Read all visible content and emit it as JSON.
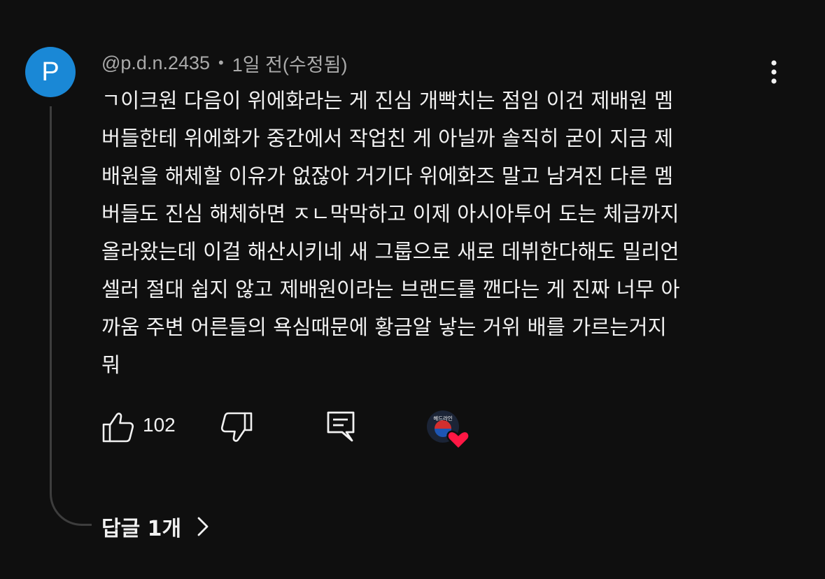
{
  "comment": {
    "avatar_letter": "P",
    "avatar_color": "#1a88d6",
    "author": "@p.d.n.2435",
    "separator": "•",
    "timestamp": "1일 전(수정됨)",
    "text": "ㄱ이크원 다음이 위에화라는 게 진심 개빡치는 점임 이건 제배원 멤\n버들한테 위에화가 중간에서 작업친 게 아닐까 솔직히 굳이 지금 제\n배원을 해체할 이유가 없잖아 거기다 위에화즈 말고 남겨진 다른 멤\n버들도 진심 해체하면 ㅈㄴ막막하고 이제 아시아투어 도는 체급까지\n올라왔는데 이걸 해산시키네 새 그룹으로 새로 데뷔한다해도 밀리언\n셀러 절대 쉽지 않고 제배원이라는 브랜드를 깬다는 게 진짜 너무 아\n까움 주변 어른들의 욕심때문에 황금알 낳는 거위 배를 가르는거지\n뭐",
    "like_count": "102",
    "replies_label": "답글 1개"
  },
  "icons": {
    "more": "more-vert-icon",
    "like": "thumbs-up-icon",
    "dislike": "thumbs-down-icon",
    "reply": "reply-comment-icon",
    "creator_heart": "creator-heart-icon",
    "expand": "chevron-right-icon"
  },
  "creator_heart": {
    "avatar_text": "헤드라인",
    "heart_color": "#ff1744"
  }
}
